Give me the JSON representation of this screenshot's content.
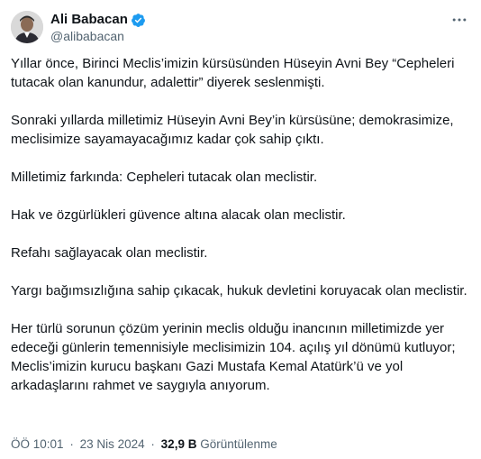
{
  "author": {
    "display_name": "Ali Babacan",
    "handle": "@alibabacan",
    "verified": true,
    "verified_color": "#1d9bf0"
  },
  "more_icon": "more-horizontal-icon",
  "paragraphs": [
    "Yıllar önce, Birinci Meclis’imizin kürsüsünden Hüseyin Avni Bey “Cepheleri tutacak olan kanundur, adalettir” diyerek seslenmişti.",
    "Sonraki yıllarda milletimiz Hüseyin Avni Bey’in kürsüsüne; demokrasimize, meclisimize sayamayacağımız kadar çok sahip çıktı.",
    "Milletimiz farkında: Cepheleri tutacak olan meclistir.",
    "Hak ve özgürlükleri güvence altına alacak olan meclistir.",
    "Refahı sağlayacak olan meclistir.",
    "Yargı bağımsızlığına sahip çıkacak, hukuk devletini koruyacak olan meclistir.",
    "Her türlü sorunun çözüm yerinin meclis olduğu inancının milletimizde yer edeceği günlerin temennisiyle meclisimizin 104. açılış yıl dönümü kutluyor; Meclis’imizin kurucu başkanı Gazi Mustafa Kemal Atatürk’ü ve yol arkadaşlarını rahmet ve saygıyla anıyorum."
  ],
  "meta": {
    "time": "ÖÖ 10:01",
    "dot": "·",
    "date": "23 Nis 2024",
    "views_count": "32,9 B",
    "views_label": "Görüntülenme"
  }
}
